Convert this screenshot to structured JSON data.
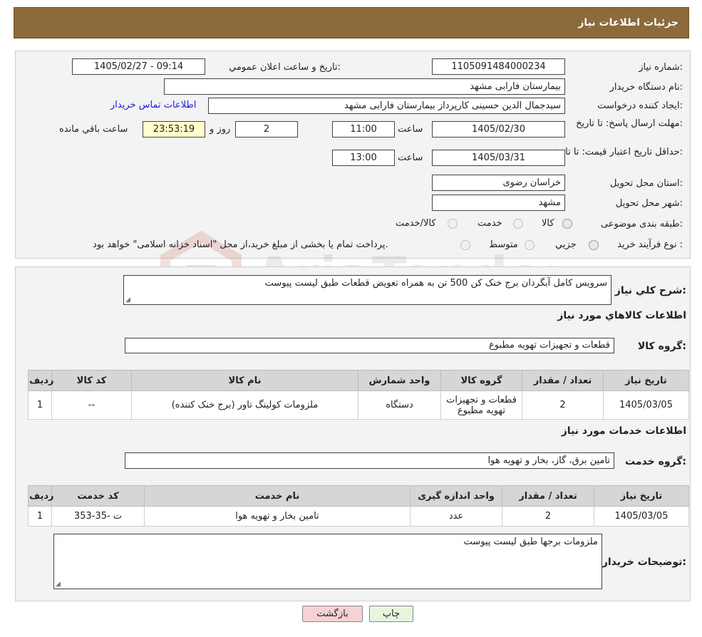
{
  "header": {
    "title": "جزئيات اطلاعات نياز"
  },
  "watermark": {
    "text": "AriaTender.neT"
  },
  "info": {
    "need_number_label": "شماره نياز:",
    "need_number": "1105091484000234",
    "announce_label": "تاريخ و ساعت اعلان عمومي:",
    "announce_value": "1405/02/27 - 09:14",
    "buyer_label": "نام دستگاه خريدار:",
    "buyer_value": "بيمارستان فارابی مشهد",
    "creator_label": "ايجاد کننده درخواست:",
    "creator_value": "سیدجمال الدین حسینی کارپرداز بیمارستان فارابی مشهد",
    "contact_link": "اطلاعات تماس خريدار",
    "deadline_label": "مهلت ارسال پاسخ: تا تاريخ:",
    "deadline_date": "1405/02/30",
    "time_label": "ساعت",
    "deadline_time": "11:00",
    "days_value": "2",
    "days_label": "روز و",
    "remaining_time": "23:53:19",
    "remaining_label": "ساعت باقي مانده",
    "validity_label": "حداقل تاريخ اعتبار قيمت: تا تاريخ:",
    "validity_date": "1405/03/31",
    "validity_time_label": "ساعت",
    "validity_time": "13:00",
    "province_label": "استان محل تحويل:",
    "province_value": "خراسان رضوی",
    "city_label": "شهر محل تحويل:",
    "city_value": "مشهد",
    "category_label": "طبقه بندی موضوعی:",
    "category_options": [
      "کالا",
      "خدمت",
      "کالا/خدمت"
    ],
    "process_label": "نوع فرآيند خريد :",
    "process_options": [
      "جزيي",
      "متوسط"
    ],
    "process_note": "پرداخت تمام يا بخشی از مبلغ خريد،از محل \"اسناد خزانه اسلامی\" خواهد بود."
  },
  "summary": {
    "description_label": "شرح کلي نياز:",
    "description_value": "سرويس کامل آبگردان برج خنک کن 500 تن به همراه تعويض قطعات طبق ليست پيوست",
    "goods_section_title": "اطلاعات کالاهاي مورد نياز",
    "goods_group_label": "گروه کالا:",
    "goods_group_value": "قطعات و تجهيزات تهويه مطبوع",
    "goods_table": {
      "headers": [
        "رديف",
        "کد کالا",
        "نام کالا",
        "واحد شمارش",
        "گروه کالا",
        "تعداد / مقدار",
        "تاريخ نياز"
      ],
      "rows": [
        [
          "1",
          "--",
          "ملزومات کولينگ تاور (برج خنک کننده)",
          "دستگاه",
          "قطعات و تجهيزات تهويه مطبوع",
          "2",
          "1405/03/05"
        ]
      ]
    },
    "services_section_title": "اطلاعات خدمات مورد نياز",
    "service_group_label": "گروه خدمت:",
    "service_group_value": "تامين برق، گاز، بخار و تهويه هوا",
    "services_table": {
      "headers": [
        "رديف",
        "کد خدمت",
        "نام خدمت",
        "واحد اندازه گيری",
        "تعداد / مقدار",
        "تاريخ نياز"
      ],
      "rows": [
        [
          "1",
          "ت -35-353",
          "تامين بخار و تهويه هوا",
          "عدد",
          "2",
          "1405/03/05"
        ]
      ]
    },
    "buyer_notes_label": "توضيحات خريدار:",
    "buyer_notes_value": "ملزومات برجها طبق ليست پيوست"
  },
  "buttons": {
    "print": "چاپ",
    "back": "بازگشت"
  },
  "colors": {
    "header_bg": "#8c6a3b",
    "back_button_bg": "#f6d2d2",
    "print_button_bg": "#e7f5dd"
  }
}
